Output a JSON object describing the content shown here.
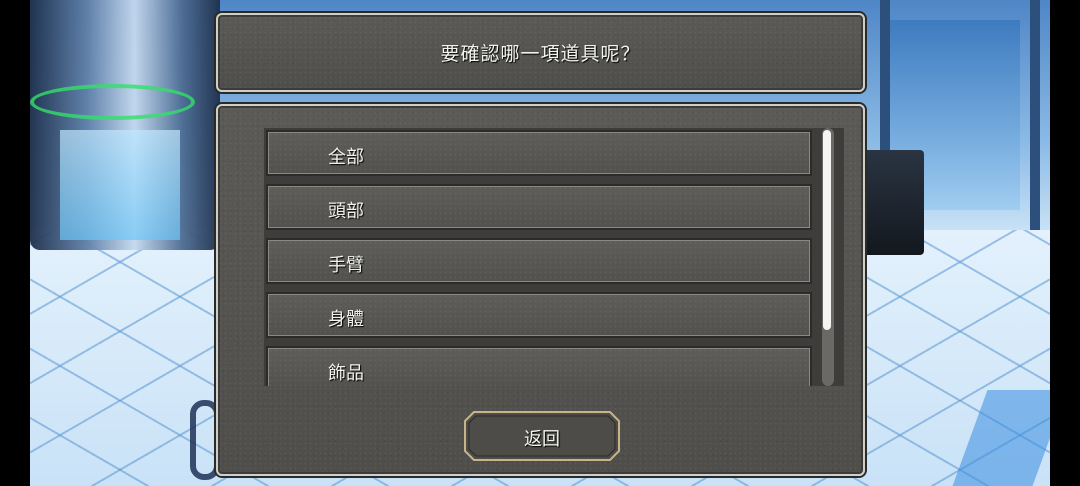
{
  "prompt": {
    "text": "要確認哪一項道具呢？"
  },
  "list": {
    "items": [
      {
        "label": "全部"
      },
      {
        "label": "頭部"
      },
      {
        "label": "手臂"
      },
      {
        "label": "身體"
      },
      {
        "label": "飾品"
      }
    ],
    "scroll_position": 0
  },
  "back_button": {
    "label": "返回"
  },
  "colors": {
    "panel_stone": "#55544f",
    "panel_border": "#cfcfc9",
    "back_button_border": "#c9b48a",
    "scroll_thumb": "#f4f4f2"
  }
}
